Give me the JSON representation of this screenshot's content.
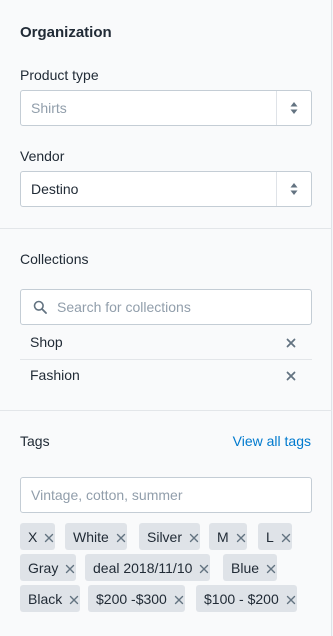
{
  "organization": {
    "title": "Organization",
    "product_type": {
      "label": "Product type",
      "placeholder": "Shirts"
    },
    "vendor": {
      "label": "Vendor",
      "value": "Destino"
    }
  },
  "collections": {
    "title": "Collections",
    "search_placeholder": "Search for collections",
    "items": [
      {
        "name": "Shop"
      },
      {
        "name": "Fashion"
      }
    ]
  },
  "tags": {
    "title": "Tags",
    "view_all_label": "View all tags",
    "input_placeholder": "Vintage, cotton, summer",
    "items": [
      "X",
      "White",
      "Silver",
      "M",
      "L",
      "Gray",
      "deal 2018/11/10",
      "Blue",
      "Black",
      "$200 -$300",
      "$100 - $200"
    ]
  },
  "icons": {
    "select_arrows": "up-down-arrows-icon",
    "search": "search-icon",
    "remove": "close-icon"
  },
  "colors": {
    "link": "#007ace",
    "tag_bg": "#dfe3e8",
    "placeholder": "#919eab",
    "icon": "#637381"
  }
}
